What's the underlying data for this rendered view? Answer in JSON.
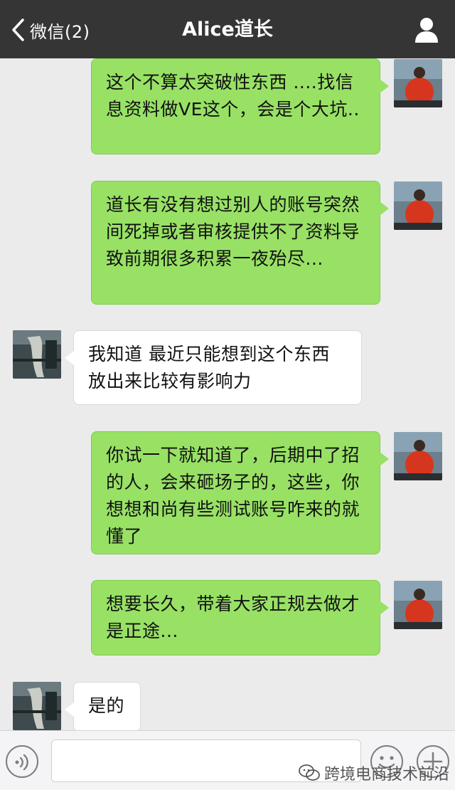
{
  "header": {
    "back_label": "微信(2)",
    "title": "Alice道长"
  },
  "messages": [
    {
      "side": "out",
      "text": "这个不算太突破性东西 ....找信息资料做VE这个，会是个大坑.."
    },
    {
      "side": "out",
      "text": "道长有没有想过别人的账号突然间死掉或者审核提供不了资料导致前期很多积累一夜殆尽..."
    },
    {
      "side": "in",
      "text": "我知道 最近只能想到这个东西放出来比较有影响力"
    },
    {
      "side": "out",
      "text": "你试一下就知道了，后期中了招的人，会来砸场子的，这些，你想想和尚有些测试账号咋来的就懂了"
    },
    {
      "side": "out",
      "text": "想要长久，带着大家正规去做才是正途..."
    },
    {
      "side": "in",
      "text": "是的"
    }
  ],
  "input": {
    "placeholder": ""
  },
  "watermark": "跨境电商技术前沿",
  "icons": {
    "back": "chevron-left-icon",
    "profile": "person-icon",
    "voice": "voice-icon",
    "emoji": "emoji-icon",
    "plus": "plus-icon"
  },
  "colors": {
    "header_bg": "#353535",
    "chat_bg": "#ebebeb",
    "outgoing_bubble": "#98e165",
    "incoming_bubble": "#ffffff"
  }
}
